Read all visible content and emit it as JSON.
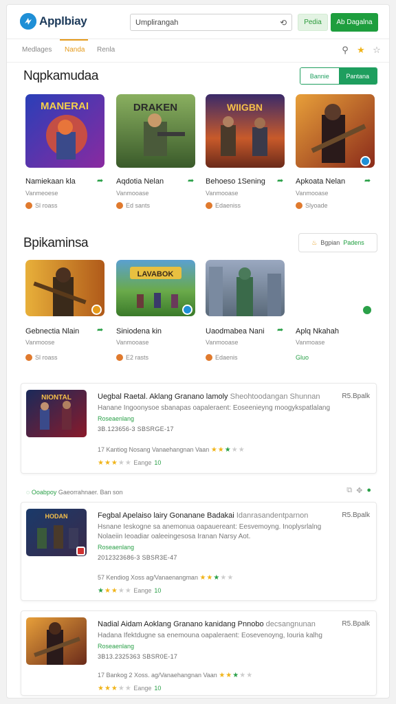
{
  "header": {
    "brand": "Applbiay",
    "search_value": "Umplirangah",
    "btn_light": "Pedia",
    "btn_primary": "Ab Dagalna"
  },
  "tabs": [
    "Medlages",
    "Nanda",
    "Renla"
  ],
  "section1": {
    "title": "Nqpkamudaa",
    "seg_a": "Bannie",
    "seg_b": "Pantana",
    "cards": [
      {
        "title": "Namiekaan kla",
        "sub": "Vanmeoese",
        "meta": "Sl roass",
        "art": "MANERAI"
      },
      {
        "title": "Aqdotia Nelan",
        "sub": "Vanmooase",
        "meta": "Ed sants",
        "art": "DRAKEN"
      },
      {
        "title": "Behoeso 1Sening",
        "sub": "Vanmooase",
        "meta": "Edaeniss",
        "art": "WIIGBN"
      },
      {
        "title": "Apkoata Nelan",
        "sub": "Vanmooase",
        "meta": "Slyoade",
        "art": ""
      }
    ]
  },
  "section2": {
    "title": "Bpikaminsa",
    "btn_label": "Bgpian",
    "btn_green": "Padens",
    "cards": [
      {
        "title": "Gebnectia Nlain",
        "sub": "Vanmoose",
        "meta": "Sl roass",
        "art": ""
      },
      {
        "title": "Siniodena kin",
        "sub": "Vanmooase",
        "meta": "E2 rasts",
        "art": "LAVABOK"
      },
      {
        "title": "Uaodmabea Nani",
        "sub": "Vanmooase",
        "meta": "Edaenis",
        "art": ""
      },
      {
        "title": "Aplq Nkahah",
        "sub": "Vanmoase",
        "meta": "Gluo",
        "art": ""
      }
    ]
  },
  "items": [
    {
      "title": "Uegbal Raetal. Aklang Granano lamoly",
      "title_tail": "Sheohtoodangan Shunnan",
      "price": "R5.Bpalk",
      "desc": "Hanane Ingoonysoe sbanapas oapaleraent: Eoseenieyng moogykspatlalang",
      "cat": "Roseaenlang",
      "code": "3B.123656-3 SBSRGE-17",
      "rating_text": "17 Kantiog Nosang Vanaehangnan Vaan",
      "foot": "Eange",
      "foot_count": "10",
      "art": "NIONTAL"
    },
    {
      "title": "Fegbal Apelaiso lairy Gonanane Badakai",
      "title_tail": "Idanrasandentparnon",
      "price": "R5.Bpalk",
      "desc": "Hsnane Ieskogne sa anemonua oapauereant: Eesvemoyng. Inoplysrlalng",
      "desc2": "Nolaeiin Ieoadiar oaleeingesosa Iranan Narsy Aot.",
      "cat": "Roseaenlang",
      "code": "2012323686-3 SBSR3E-47",
      "rating_text": "57 Kendiog Xoss ag/Vanaenangman",
      "foot": "Eange",
      "foot_count": "10",
      "art": "HODAN"
    },
    {
      "title": "Nadial Aidam Aoklang Granano kanidang Pnnobo",
      "title_tail": "decsangnunan",
      "price": "R5.Bpalk",
      "desc": "Hadana Ifektdugne sa enemouna oapaleraent: Eosevenoyng, Iouria kalhg",
      "cat": "Roseaenlang",
      "code": "3B13.2325363 SBSR0E-17",
      "rating_text": "17 Bankog 2 Xoss. ag/Vanaehangnan Vaan",
      "foot": "Eange",
      "foot_count": "10",
      "art": ""
    }
  ],
  "info_line": {
    "green": "Ooabpoy",
    "rest": "Gaeorrahnaer. Ban son"
  },
  "colors": {
    "green": "#1e9e3e",
    "orange": "#e59a1a",
    "blue": "#1f8fd6"
  },
  "icons": {
    "search": "search-icon",
    "star": "star-icon",
    "share": "share-icon"
  }
}
